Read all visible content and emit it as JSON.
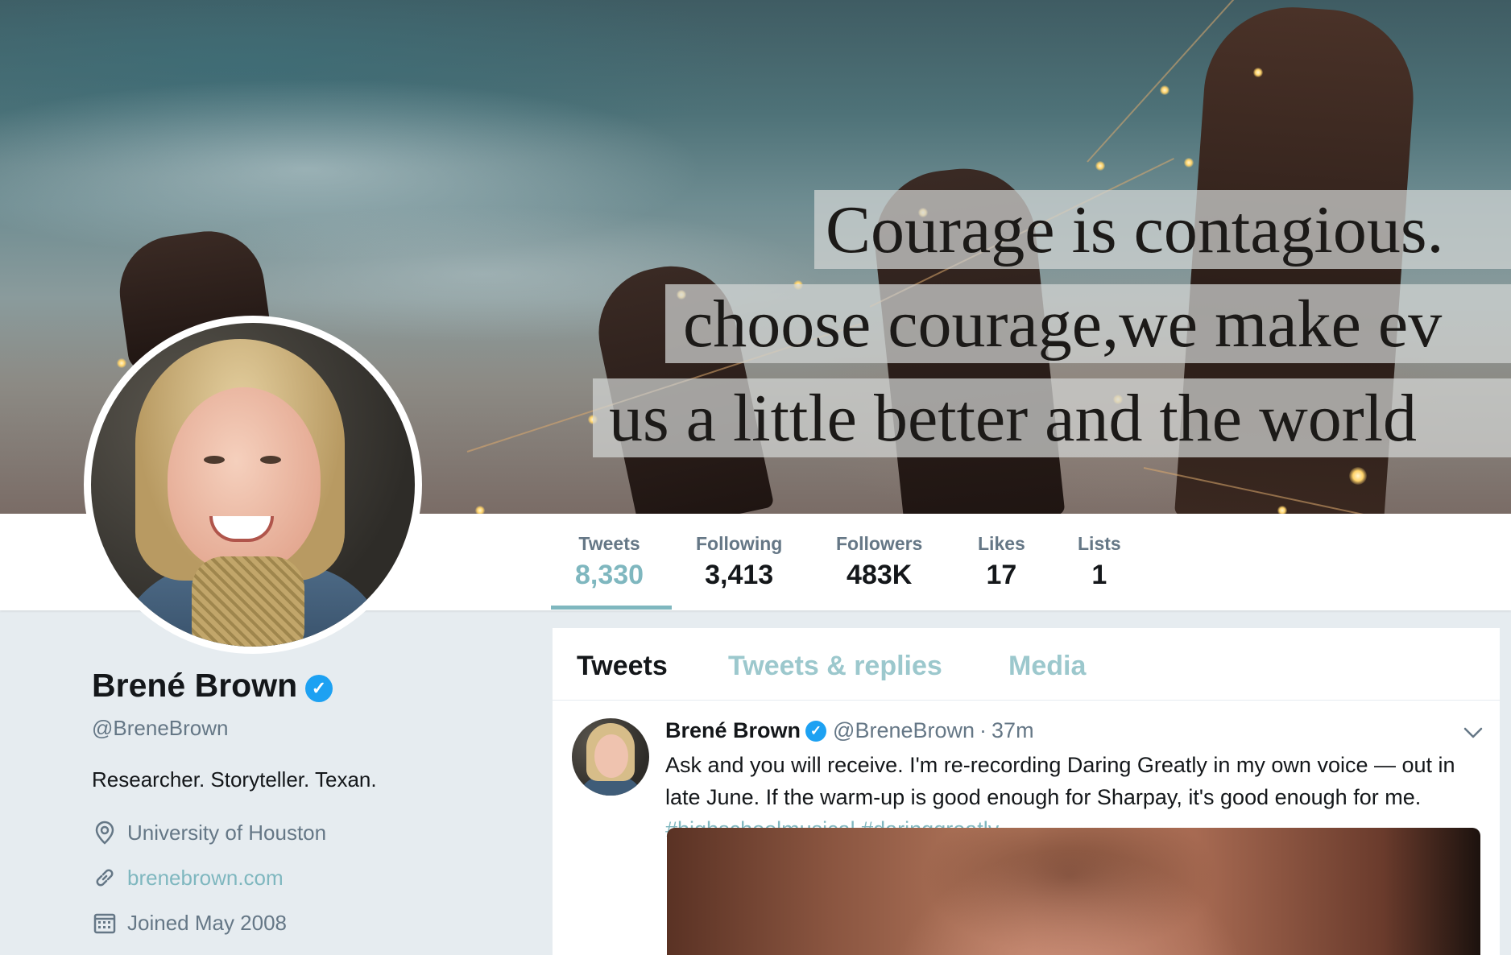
{
  "banner": {
    "quote_lines": [
      "Courage is contagious.",
      "choose courage,we make ev",
      "us a little better and the world"
    ]
  },
  "stats": [
    {
      "label": "Tweets",
      "value": "8,330",
      "active": true
    },
    {
      "label": "Following",
      "value": "3,413",
      "active": false
    },
    {
      "label": "Followers",
      "value": "483K",
      "active": false
    },
    {
      "label": "Likes",
      "value": "17",
      "active": false
    },
    {
      "label": "Lists",
      "value": "1",
      "active": false
    }
  ],
  "profile": {
    "name": "Brené Brown",
    "handle": "@BreneBrown",
    "bio": "Researcher. Storyteller. Texan.",
    "location": "University of Houston",
    "website": "brenebrown.com",
    "joined": "Joined May 2008",
    "verified_glyph": "✓"
  },
  "timeline": {
    "tabs": [
      {
        "label": "Tweets",
        "active": true
      },
      {
        "label": "Tweets & replies",
        "active": false
      },
      {
        "label": "Media",
        "active": false
      }
    ],
    "tweet": {
      "name": "Brené Brown",
      "handle": "@BreneBrown",
      "separator": "·",
      "time": "37m",
      "text": "Ask and you will receive. I'm re-recording Daring Greatly in my own voice — out in late June. If the warm-up is good enough for Sharpay, it's good enough for me.",
      "hashtags": "#highschoolmusical #daringgreatly"
    }
  },
  "colors": {
    "accent": "#7fb7bf",
    "verified": "#1da1f2",
    "text_primary": "#14171a",
    "text_secondary": "#657786",
    "background": "#e6ecf0"
  },
  "icons": [
    "location-pin-icon",
    "link-icon",
    "calendar-icon",
    "verified-badge-icon",
    "chevron-down-icon"
  ]
}
